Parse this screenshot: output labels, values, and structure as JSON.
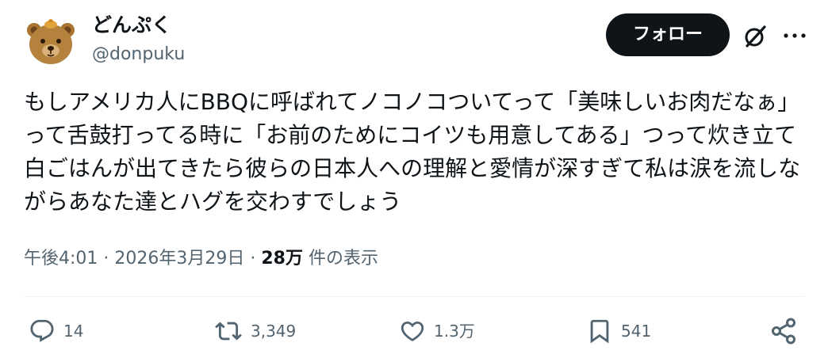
{
  "author": {
    "display_name": "どんぷく",
    "handle": "@donpuku",
    "avatar_icon": "bear-avatar-icon"
  },
  "header": {
    "follow_label": "フォロー",
    "grok_icon": "grok-icon",
    "more_icon": "more-dots-icon"
  },
  "tweet": {
    "text": "もしアメリカ人にBBQに呼ばれてノコノコついてって「美味しいお肉だなぁ」って舌鼓打ってる時に「お前のためにコイツも用意してある」つって炊き立て白ごはんが出てきたら彼らの日本人への理解と愛情が深すぎて私は涙を流しながらあなた達とハグを交わすでしょう"
  },
  "meta": {
    "time": "午後4:01",
    "separator1": " · ",
    "date": "2026年3月29日",
    "separator2": " · ",
    "views": "28万",
    "views_suffix": " 件の表示"
  },
  "actions": {
    "replies": "14",
    "reposts": "3,349",
    "likes": "1.3万",
    "bookmarks": "541"
  },
  "colors": {
    "text": "#0f1419",
    "secondary": "#536471",
    "follow_bg": "#0f1419",
    "divider": "#eff3f4",
    "avatar_bear": "#b5823d",
    "avatar_hat": "#e0a43a"
  }
}
